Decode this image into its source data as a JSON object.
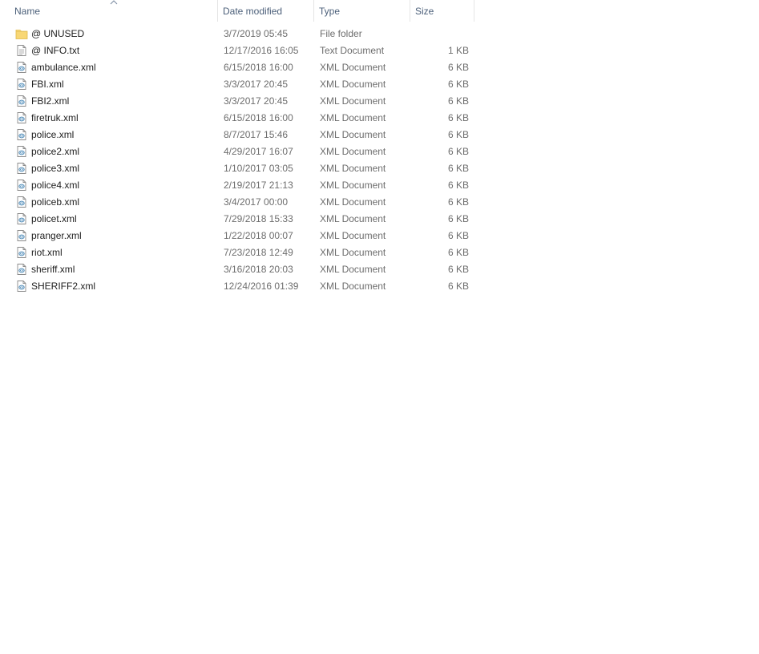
{
  "columns": {
    "name": "Name",
    "date_modified": "Date modified",
    "type": "Type",
    "size": "Size"
  },
  "sort_icon": "chevron-up-icon",
  "colors": {
    "header_text": "#4c607a",
    "folder_yellow": "#f8d775",
    "secondary_text": "#6d6d6d"
  },
  "files": [
    {
      "name": "@ UNUSED",
      "date": "3/7/2019 05:45",
      "type": "File folder",
      "size": "",
      "icon": "folder-icon"
    },
    {
      "name": "@ INFO.txt",
      "date": "12/17/2016 16:05",
      "type": "Text Document",
      "size": "1 KB",
      "icon": "text-document-icon"
    },
    {
      "name": "ambulance.xml",
      "date": "6/15/2018 16:00",
      "type": "XML Document",
      "size": "6 KB",
      "icon": "xml-document-icon"
    },
    {
      "name": "FBI.xml",
      "date": "3/3/2017 20:45",
      "type": "XML Document",
      "size": "6 KB",
      "icon": "xml-document-icon"
    },
    {
      "name": "FBI2.xml",
      "date": "3/3/2017 20:45",
      "type": "XML Document",
      "size": "6 KB",
      "icon": "xml-document-icon"
    },
    {
      "name": "firetruk.xml",
      "date": "6/15/2018 16:00",
      "type": "XML Document",
      "size": "6 KB",
      "icon": "xml-document-icon"
    },
    {
      "name": "police.xml",
      "date": "8/7/2017 15:46",
      "type": "XML Document",
      "size": "6 KB",
      "icon": "xml-document-icon"
    },
    {
      "name": "police2.xml",
      "date": "4/29/2017 16:07",
      "type": "XML Document",
      "size": "6 KB",
      "icon": "xml-document-icon"
    },
    {
      "name": "police3.xml",
      "date": "1/10/2017 03:05",
      "type": "XML Document",
      "size": "6 KB",
      "icon": "xml-document-icon"
    },
    {
      "name": "police4.xml",
      "date": "2/19/2017 21:13",
      "type": "XML Document",
      "size": "6 KB",
      "icon": "xml-document-icon"
    },
    {
      "name": "policeb.xml",
      "date": "3/4/2017 00:00",
      "type": "XML Document",
      "size": "6 KB",
      "icon": "xml-document-icon"
    },
    {
      "name": "policet.xml",
      "date": "7/29/2018 15:33",
      "type": "XML Document",
      "size": "6 KB",
      "icon": "xml-document-icon"
    },
    {
      "name": "pranger.xml",
      "date": "1/22/2018 00:07",
      "type": "XML Document",
      "size": "6 KB",
      "icon": "xml-document-icon"
    },
    {
      "name": "riot.xml",
      "date": "7/23/2018 12:49",
      "type": "XML Document",
      "size": "6 KB",
      "icon": "xml-document-icon"
    },
    {
      "name": "sheriff.xml",
      "date": "3/16/2018 20:03",
      "type": "XML Document",
      "size": "6 KB",
      "icon": "xml-document-icon"
    },
    {
      "name": "SHERIFF2.xml",
      "date": "12/24/2016 01:39",
      "type": "XML Document",
      "size": "6 KB",
      "icon": "xml-document-icon"
    }
  ]
}
